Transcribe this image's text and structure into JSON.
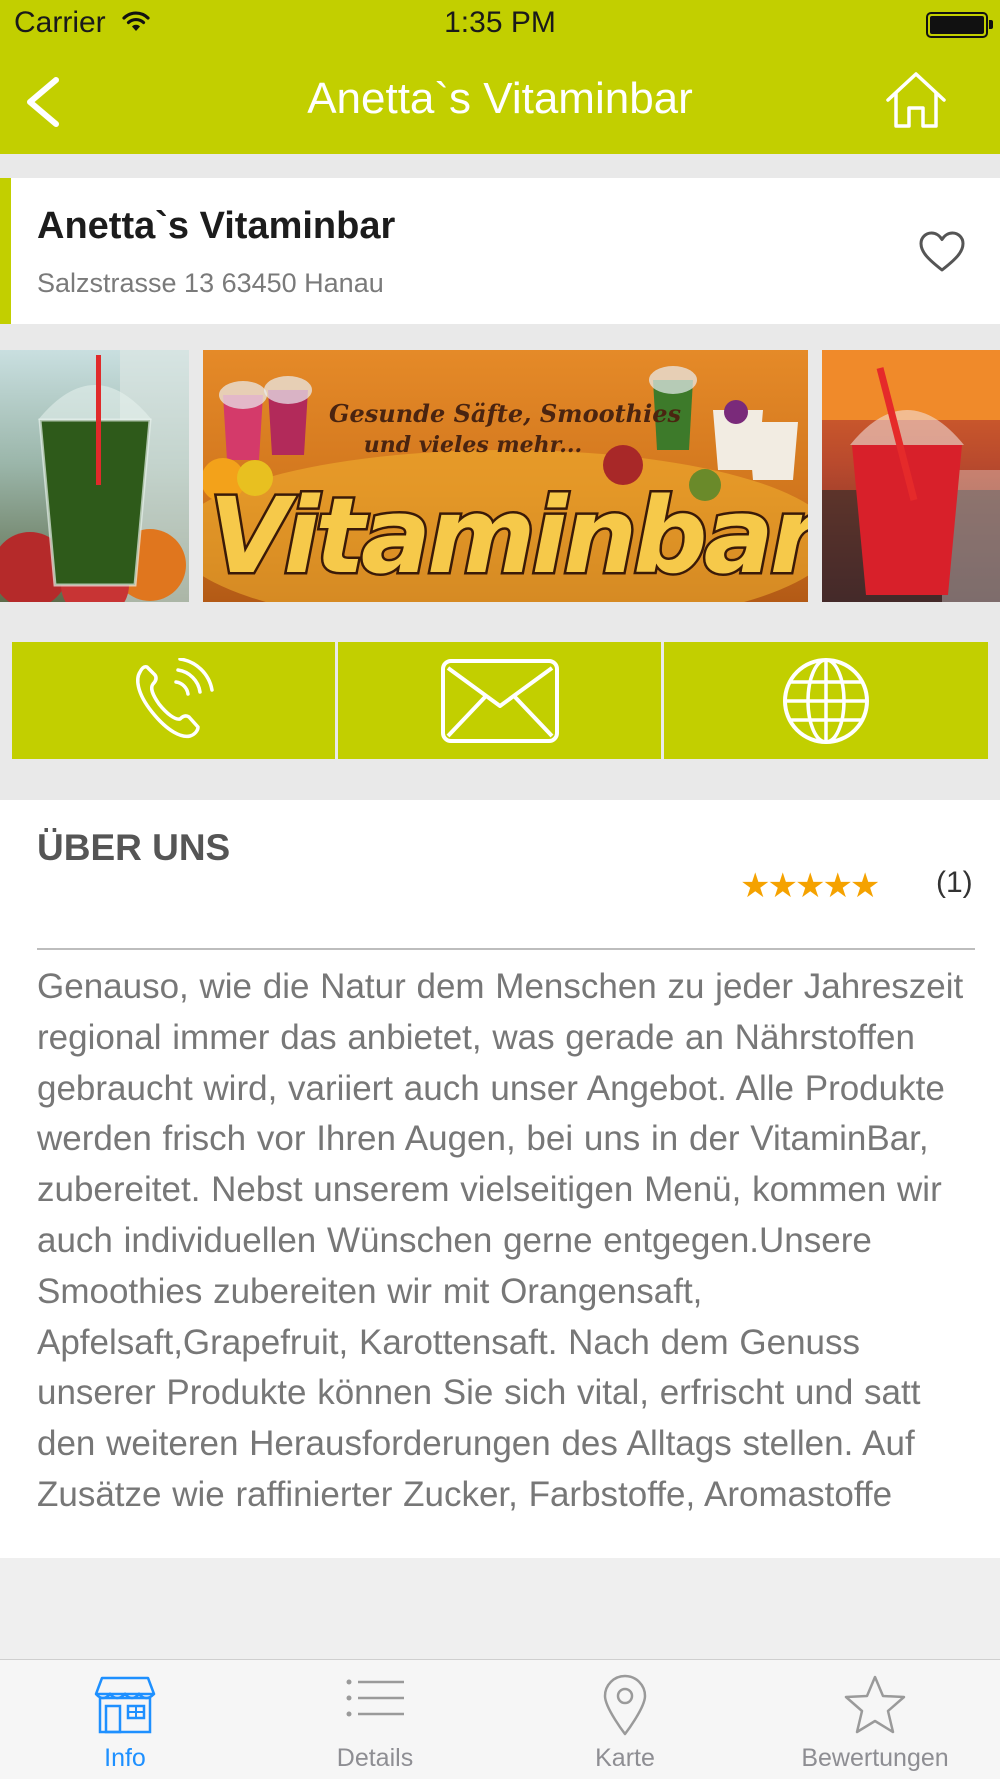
{
  "status_bar": {
    "carrier": "Carrier",
    "time": "1:35 PM"
  },
  "nav": {
    "title": "Anetta`s Vitaminbar",
    "back_icon": "chevron-left-icon",
    "home_icon": "home-icon"
  },
  "business": {
    "name": "Anetta`s Vitaminbar",
    "address": "Salzstrasse 13 63450 Hanau",
    "favorite_icon": "heart-outline-icon"
  },
  "gallery": {
    "banner_line1": "Gesunde Säfte, Smoothies",
    "banner_line2": "und vieles mehr...",
    "banner_word": "Vitaminbar"
  },
  "contact_icons": [
    "phone-icon",
    "mail-icon",
    "globe-icon"
  ],
  "about": {
    "heading": "ÜBER UNS",
    "stars": "★★★★★",
    "rating_value": 5,
    "rating_count": "(1)",
    "text": "Genauso, wie die Natur dem Menschen zu jeder Jahreszeit regional immer das anbietet, was gerade an Nährstoffen gebraucht wird, variiert auch unser Angebot. Alle Produkte werden frisch vor Ihren Augen, bei uns in der VitaminBar, zubereitet. Nebst unserem vielseitigen Menü, kommen wir auch individuellen Wünschen gerne entgegen.Unsere Smoothies zubereiten wir mit Orangensaft, Apfelsaft,Grapefruit, Karottensaft. Nach dem Genuss unserer Produkte können Sie sich vital, erfrischt und satt den weiteren Herausforderungen des Alltags stellen. Auf Zusätze wie raffinierter Zucker, Farbstoffe, Aromastoffe"
  },
  "tabs": [
    {
      "label": "Info",
      "icon": "store-icon",
      "active": true
    },
    {
      "label": "Details",
      "icon": "list-icon",
      "active": false
    },
    {
      "label": "Karte",
      "icon": "map-pin-icon",
      "active": false
    },
    {
      "label": "Bewertungen",
      "icon": "star-icon",
      "active": false
    }
  ],
  "colors": {
    "accent": "#c2cf00",
    "tab_active": "#1e90ff",
    "stars": "#f5a200"
  }
}
